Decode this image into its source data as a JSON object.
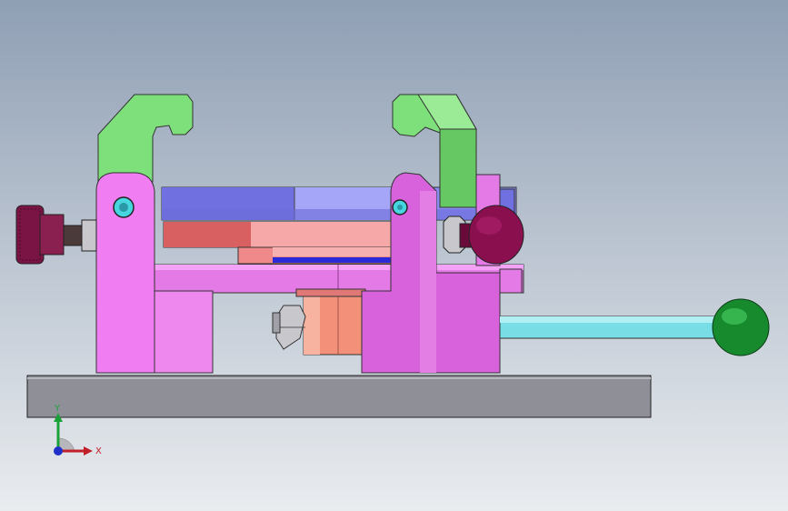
{
  "viewport": {
    "background_top": "#8f9fb4",
    "background_bottom": "#e9ecef"
  },
  "model": {
    "parts": [
      {
        "name": "base-plate",
        "color": "#8f8f98"
      },
      {
        "name": "left-pink-bracket",
        "color": "#f07ef2"
      },
      {
        "name": "right-pink-bracket",
        "color": "#d862dc"
      },
      {
        "name": "green-hook",
        "color": "#7ee07a"
      },
      {
        "name": "blue-disc",
        "color": "#8c8cf0"
      },
      {
        "name": "salmon-bar",
        "color": "#f08a8a"
      },
      {
        "name": "pink-plate",
        "color": "#e47ae6"
      },
      {
        "name": "orange-block",
        "color": "#f2907a"
      },
      {
        "name": "knurled-knob",
        "color": "#7a1444"
      },
      {
        "name": "maroon-knob",
        "color": "#8a0f4f"
      },
      {
        "name": "cyan-rod",
        "color": "#78dde4"
      },
      {
        "name": "green-ball",
        "color": "#178a2e"
      },
      {
        "name": "hex-nut",
        "color": "#c8c8cc"
      }
    ]
  },
  "triad": {
    "x_label": "X",
    "y_label": "Y",
    "x_color": "#c0202a",
    "y_color": "#1aa13a",
    "z_color": "#2030c8"
  }
}
